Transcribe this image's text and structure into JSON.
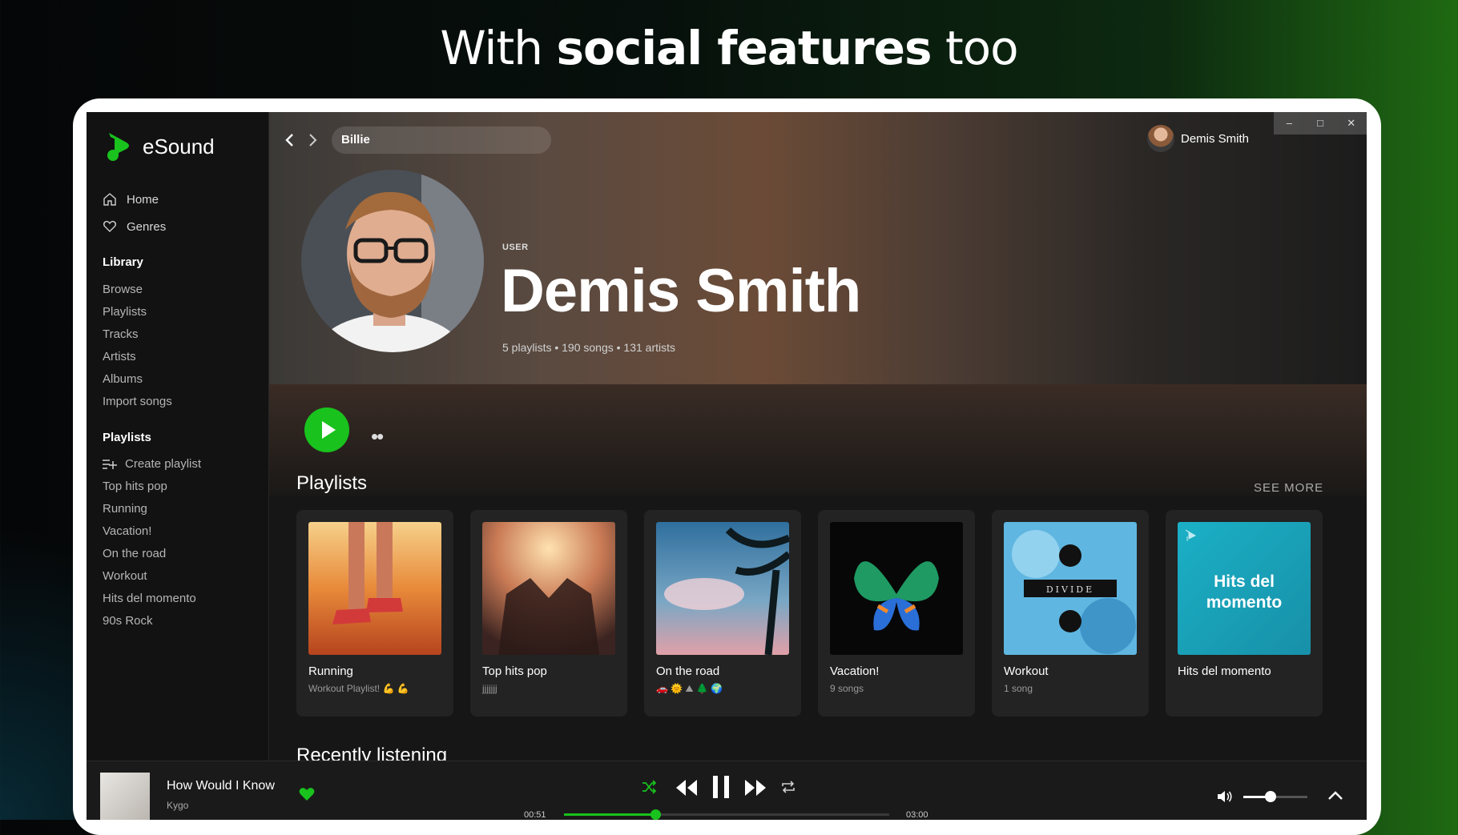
{
  "headline": {
    "prefix": "With",
    "bold": "social features",
    "suffix": "too"
  },
  "app": {
    "name": "eSound"
  },
  "nav": [
    {
      "label": "Home",
      "icon": "home-icon"
    },
    {
      "label": "Genres",
      "icon": "heart-outline-icon"
    }
  ],
  "library": {
    "title": "Library",
    "items": [
      "Browse",
      "Playlists",
      "Tracks",
      "Artists",
      "Albums",
      "Import songs"
    ]
  },
  "playlists_sidebar": {
    "title": "Playlists",
    "create_label": "Create playlist",
    "items": [
      "Top hits pop",
      "Running",
      "Vacation!",
      "On the road",
      "Workout",
      "Hits del momento",
      "90s Rock"
    ]
  },
  "search": {
    "value": "Billie"
  },
  "current_user": {
    "name": "Demis Smith"
  },
  "window_controls": [
    "–",
    "□",
    "✕"
  ],
  "profile": {
    "type": "USER",
    "name": "Demis Smith",
    "stats": "5 playlists • 190 songs • 131 artists"
  },
  "more_label": "••",
  "playlists_section": {
    "heading": "Playlists",
    "see_more": "SEE MORE",
    "cards": [
      {
        "title": "Running",
        "subtitle": "Workout Playlist! 💪 💪"
      },
      {
        "title": "Top hits pop",
        "subtitle": "jjjjjjj"
      },
      {
        "title": "On the road",
        "subtitle": "🚗 🌞 ⛰ 🌲 🌍"
      },
      {
        "title": "Vacation!",
        "subtitle": "9 songs"
      },
      {
        "title": "Workout",
        "subtitle": "1 song"
      },
      {
        "title": "Hits del momento",
        "subtitle": ""
      }
    ],
    "cover_text": {
      "divide": "DIVIDE",
      "hits": "Hits del momento"
    }
  },
  "next_section": {
    "heading": "Recently listening"
  },
  "player": {
    "title": "How Would I Know",
    "artist": "Kygo",
    "liked": true,
    "elapsed": "00:51",
    "duration": "03:00",
    "progress": 0.28,
    "volume": 0.42
  },
  "colors": {
    "accent": "#19c21d",
    "sidebar_bg": "#121212",
    "card_bg": "#232323"
  }
}
